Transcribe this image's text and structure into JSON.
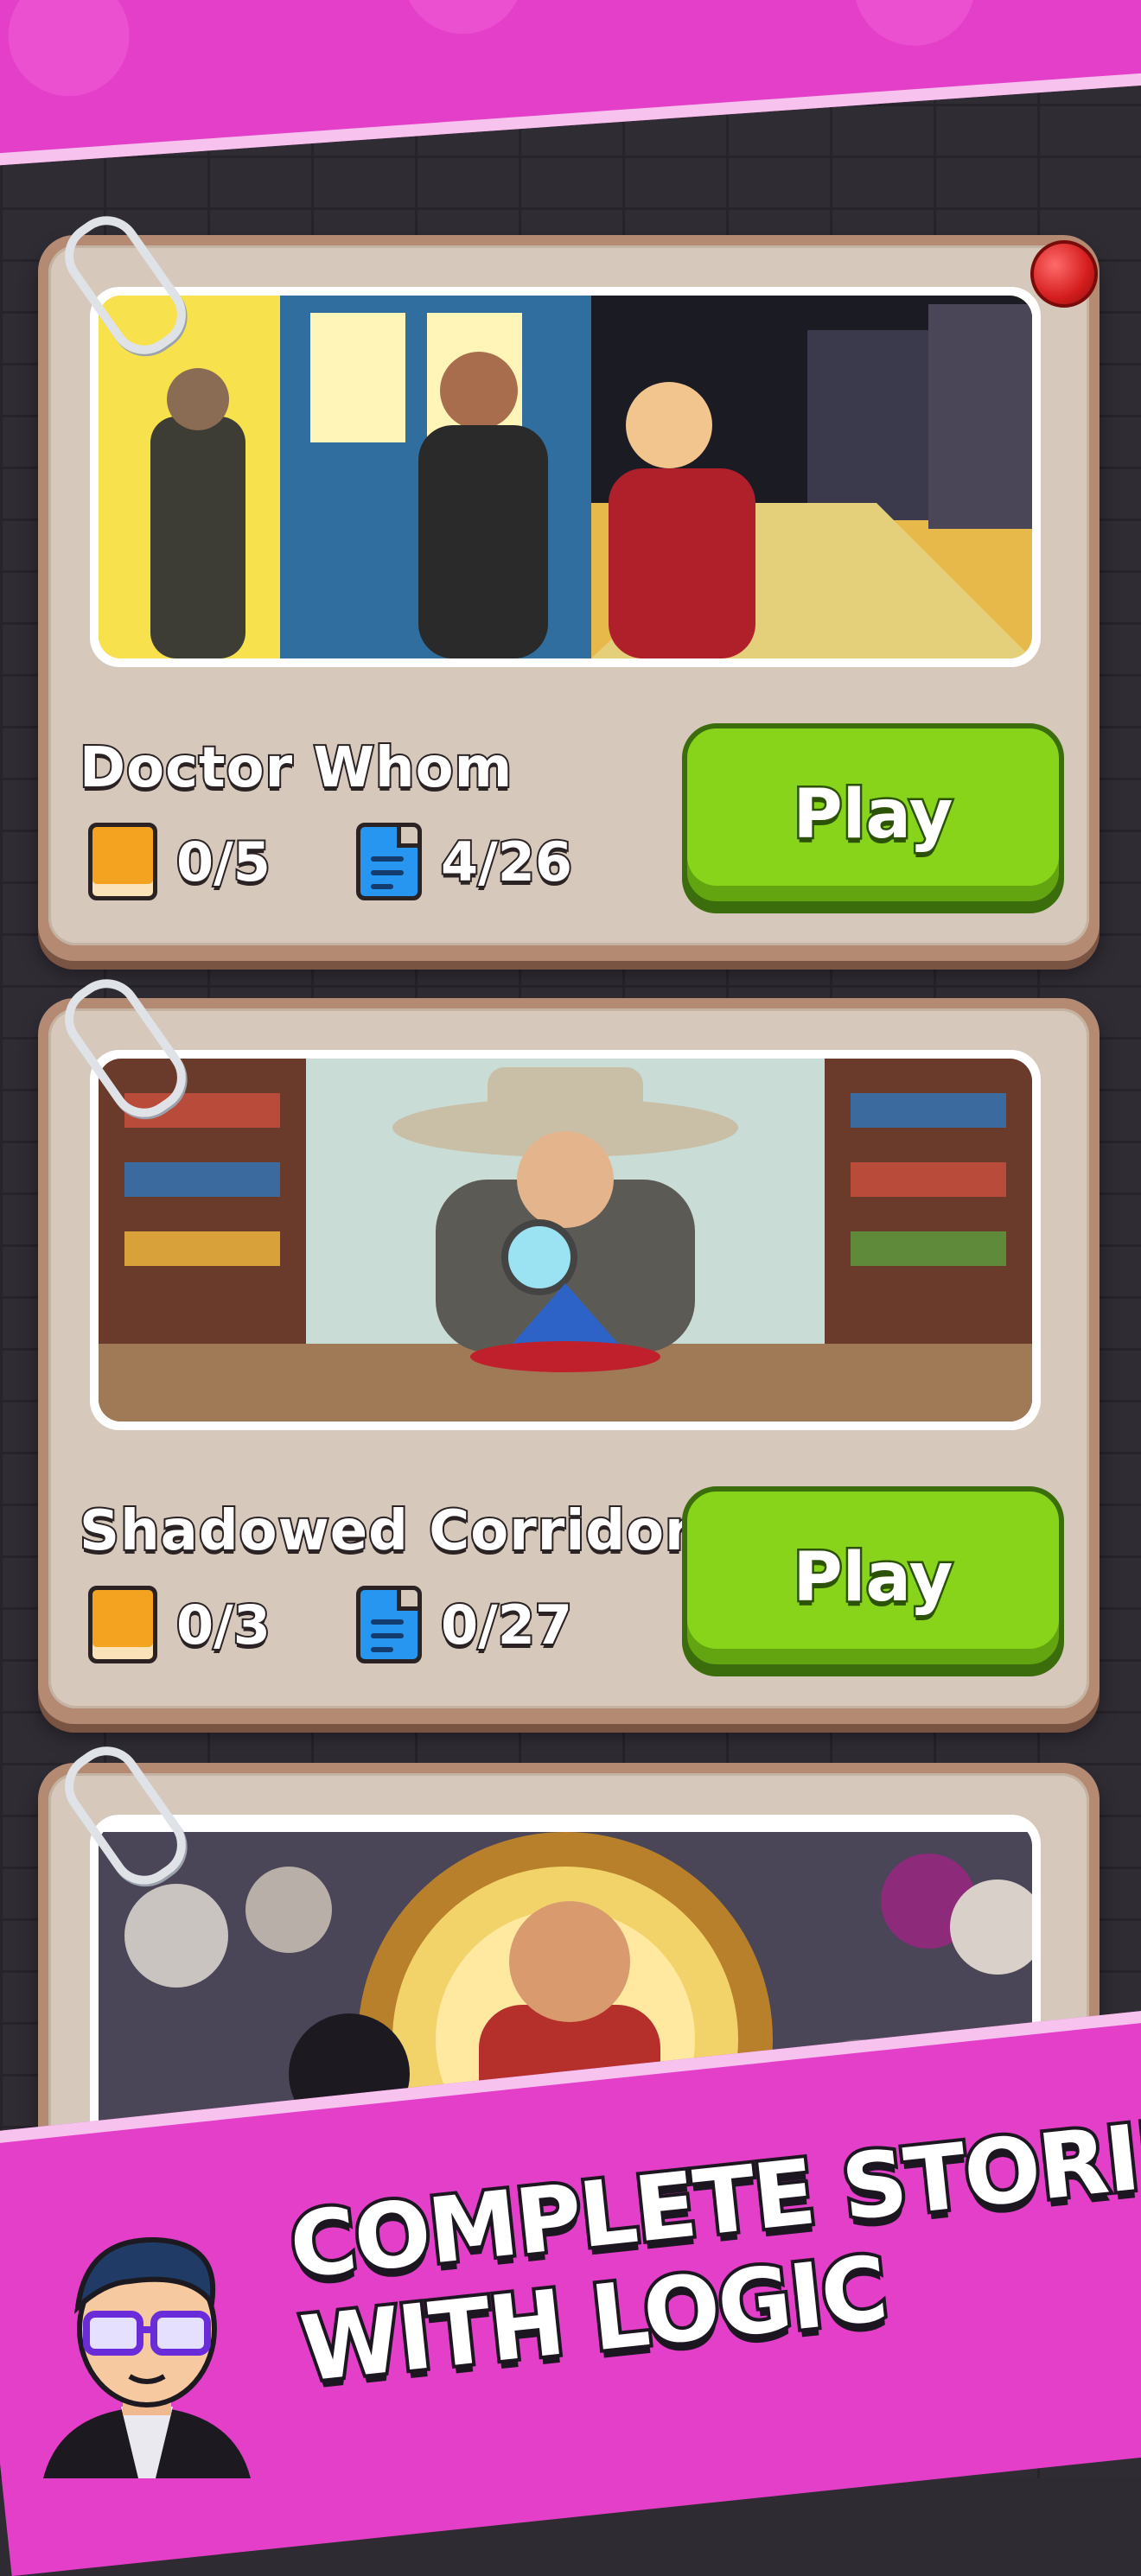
{
  "stories": [
    {
      "title": "Doctor Whom",
      "chapters": "0/5",
      "clues": "4/26",
      "play_label": "Play",
      "art": "street-scene"
    },
    {
      "title": "Shadowed Corridor",
      "chapters": "0/3",
      "clues": "0/27",
      "play_label": "Play",
      "art": "detective-scene"
    },
    {
      "title": "",
      "art": "clock-villains"
    }
  ],
  "icons": {
    "chapters": "book-icon",
    "clues": "document-icon"
  },
  "promo": {
    "line1": "COMPLETE STORIES",
    "line2": "WITH LOGIC"
  },
  "colors": {
    "banner": "#e43fc9",
    "play": "#88d41a",
    "card": "#d6c9bb"
  }
}
